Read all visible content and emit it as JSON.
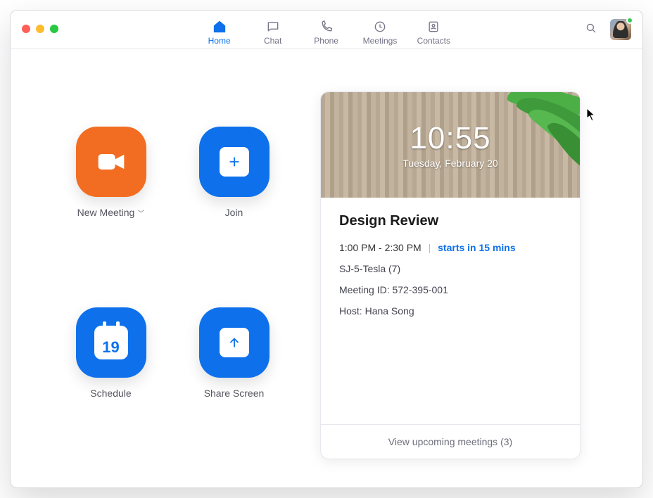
{
  "nav": {
    "home": {
      "label": "Home"
    },
    "chat": {
      "label": "Chat"
    },
    "phone": {
      "label": "Phone"
    },
    "meetings": {
      "label": "Meetings"
    },
    "contacts": {
      "label": "Contacts"
    }
  },
  "actions": {
    "new_meeting": {
      "label": "New Meeting"
    },
    "join": {
      "label": "Join"
    },
    "schedule": {
      "label": "Schedule",
      "day": "19"
    },
    "share": {
      "label": "Share Screen"
    }
  },
  "clock": {
    "time": "10:55",
    "date": "Tuesday, February 20"
  },
  "meeting": {
    "title": "Design Review",
    "time_range": "1:00 PM - 2:30 PM",
    "starts_in": "starts in 15 mins",
    "room": "SJ-5-Tesla (7)",
    "meeting_id_label": "Meeting ID: ",
    "meeting_id": "572-395-001",
    "host_label": "Host: ",
    "host": "Hana Song"
  },
  "footer": {
    "upcoming": "View upcoming meetings (3)"
  }
}
